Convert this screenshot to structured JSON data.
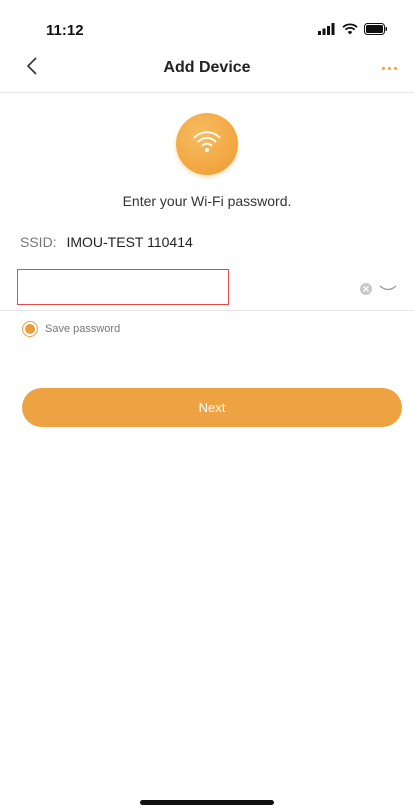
{
  "status_bar": {
    "time": "11:12",
    "icons": [
      "signal-icon",
      "wifi-icon",
      "battery-icon"
    ]
  },
  "header": {
    "title": "Add Device",
    "back_icon": "chevron-left-icon",
    "more_icon": "more-dots-icon"
  },
  "main": {
    "prompt": "Enter your Wi-Fi password.",
    "ssid_label": "SSID:",
    "ssid_value": "IMOU-TEST 110414",
    "password": {
      "value": "",
      "placeholder": ""
    },
    "save_password": {
      "label": "Save password",
      "checked": true
    },
    "next_label": "Next"
  },
  "colors": {
    "accent": "#EEA343",
    "error_border": "#E24B4B"
  }
}
